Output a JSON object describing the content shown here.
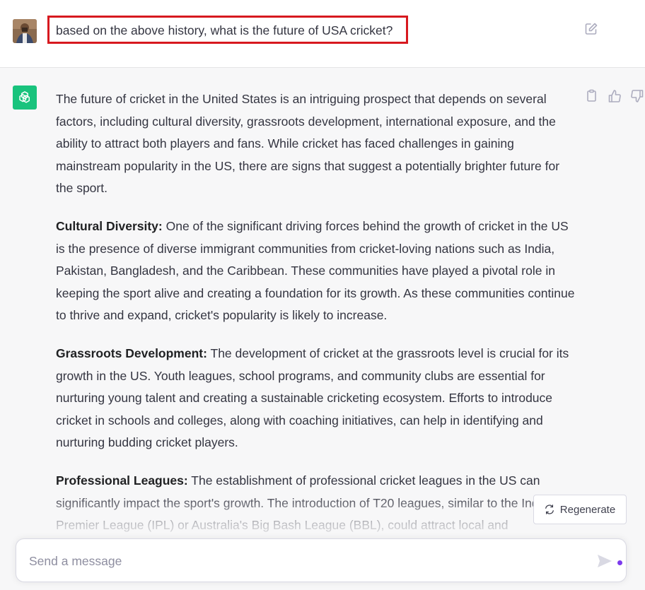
{
  "user": {
    "avatar_icon": "user-avatar",
    "message": "based on the above history, what is the future of USA cricket?"
  },
  "assistant": {
    "avatar_icon": "openai-logo-icon",
    "accent": "#19c37d",
    "paragraphs": [
      {
        "heading": "",
        "text": "The future of cricket in the United States is an intriguing prospect that depends on several factors, including cultural diversity, grassroots development, international exposure, and the ability to attract both players and fans. While cricket has faced challenges in gaining mainstream popularity in the US, there are signs that suggest a potentially brighter future for the sport."
      },
      {
        "heading": "Cultural Diversity:",
        "text": " One of the significant driving forces behind the growth of cricket in the US is the presence of diverse immigrant communities from cricket-loving nations such as India, Pakistan, Bangladesh, and the Caribbean. These communities have played a pivotal role in keeping the sport alive and creating a foundation for its growth. As these communities continue to thrive and expand, cricket's popularity is likely to increase."
      },
      {
        "heading": "Grassroots Development:",
        "text": " The development of cricket at the grassroots level is crucial for its growth in the US. Youth leagues, school programs, and community clubs are essential for nurturing young talent and creating a sustainable cricketing ecosystem. Efforts to introduce cricket in schools and colleges, along with coaching initiatives, can help in identifying and nurturing budding cricket players."
      },
      {
        "heading": "Professional Leagues:",
        "text": " The establishment of professional cricket leagues in the US can significantly impact the sport's growth. The introduction of T20 leagues, similar to the Indian Premier League (IPL) or Australia's Big Bash League (BBL), could attract local and"
      }
    ]
  },
  "controls": {
    "regenerate_label": "Regenerate",
    "composer_placeholder": "Send a message",
    "send_icon": "send-icon",
    "highlight_color": "#d7191f"
  }
}
